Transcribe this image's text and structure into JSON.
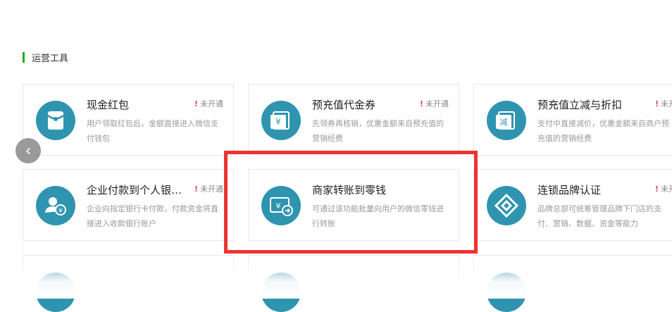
{
  "section": {
    "title": "运营工具"
  },
  "cards": [
    {
      "name": "现金红包",
      "status_mark": "!",
      "status": "未开通",
      "desc": "用户领取红包后，金额直接进入微信支付钱包",
      "icon": "red-envelope-icon"
    },
    {
      "name": "预充值代金券",
      "status_mark": "!",
      "status": "未开通",
      "desc": "先领券再核销，优惠金额来自预充值的营销经费",
      "icon": "yen-voucher-icon",
      "icon_text": "¥"
    },
    {
      "name": "预充值立减与折扣",
      "status_mark": "!",
      "status": "未开通",
      "desc": "支付中直接减价，优惠金额来自商户预充值的营销经费",
      "icon": "discount-voucher-icon",
      "icon_text": "减"
    },
    {
      "name": "企业付款到个人银…",
      "status_mark": "!",
      "status": "未开通",
      "desc": "企业向指定银行卡付款，付款资金将直接进入收款银行账户",
      "icon": "group-payment-icon",
      "icon_text": "¥"
    },
    {
      "name": "商家转账到零钱",
      "status_mark": "",
      "status": "",
      "desc": "可通过该功能批量向用户的微信零钱进行转账",
      "icon": "wallet-transfer-icon",
      "icon_text": "¥"
    },
    {
      "name": "连锁品牌认证",
      "status_mark": "!",
      "status": "未开通",
      "desc": "品牌总部可统筹管理品牌下门店的支付、营销、数据、资金等能力",
      "icon": "chain-brand-icon"
    },
    {
      "name": "",
      "status_mark": "",
      "status": "",
      "desc": "",
      "icon": "voucher-icon"
    },
    {
      "name": "",
      "status_mark": "",
      "status": "",
      "desc": "",
      "icon": "discount-icon"
    },
    {
      "name": "",
      "status_mark": "",
      "status": "",
      "desc": "",
      "icon": "mini-program-red-envelope-icon"
    }
  ],
  "carousel": {
    "prev_icon": "chevron-left-icon",
    "prev_glyph": "‹"
  },
  "colors": {
    "icon_bg": "#2f94b0",
    "section_bar": "#1aad19",
    "highlight": "#ee3232",
    "status_mark": "#e64340"
  }
}
